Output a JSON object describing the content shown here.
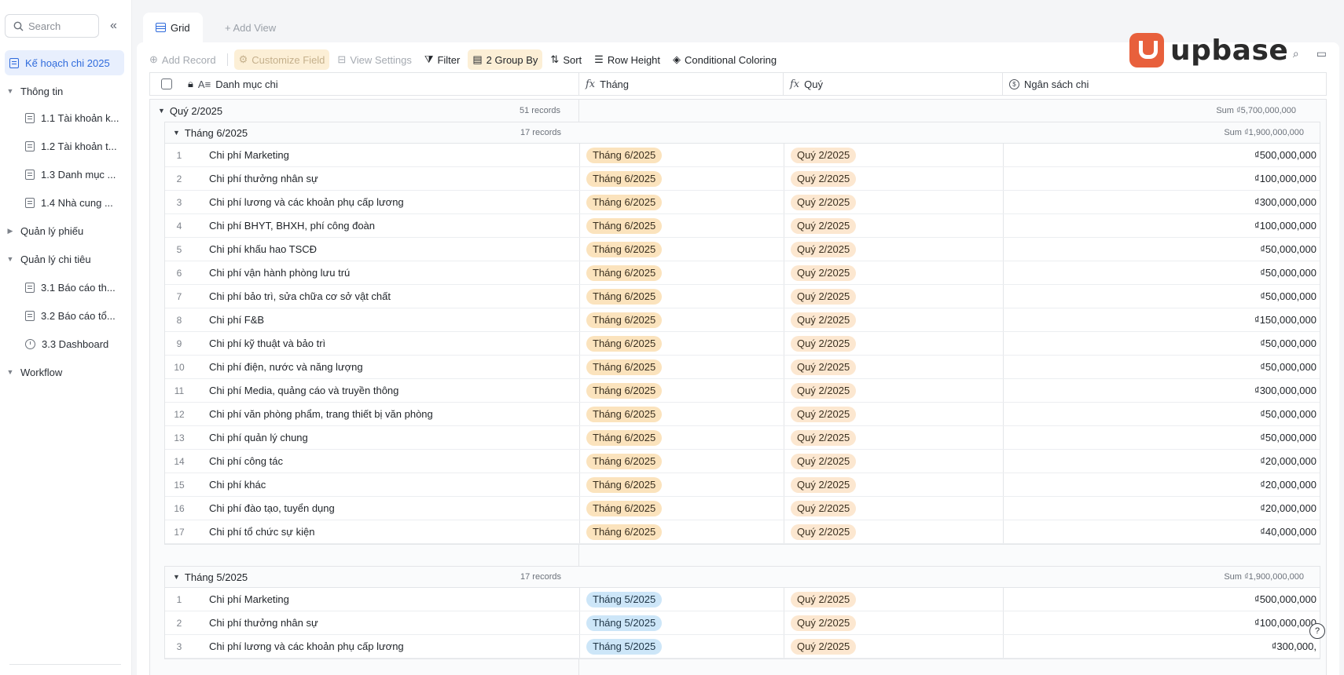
{
  "sidebar": {
    "search_placeholder": "Search",
    "collapse_icon": "double-chevron-left-icon",
    "items": [
      {
        "label": "Kế hoạch chi 2025"
      },
      {
        "label": "Thông tin"
      },
      {
        "label": "1.1 Tài khoản k..."
      },
      {
        "label": "1.2 Tài khoản t..."
      },
      {
        "label": "1.3 Danh mục ..."
      },
      {
        "label": "1.4 Nhà cung ..."
      },
      {
        "label": "Quản lý phiếu"
      },
      {
        "label": "Quản lý chi tiêu"
      },
      {
        "label": "3.1 Báo cáo th..."
      },
      {
        "label": "3.2 Báo cáo tổ..."
      },
      {
        "label": "3.3 Dashboard"
      },
      {
        "label": "Workflow"
      }
    ]
  },
  "tabs": {
    "grid": "Grid",
    "add_view": "+ Add View"
  },
  "toolbar": {
    "add_record": "Add Record",
    "customize_field": "Customize Field",
    "view_settings": "View Settings",
    "filter": "Filter",
    "group_by": "2 Group By",
    "sort": "Sort",
    "row_height": "Row Height",
    "conditional_coloring": "Conditional Coloring"
  },
  "brand": {
    "name": "upbase",
    "color": "#e8603c"
  },
  "columns": {
    "name": "Danh mục chi",
    "thang": "Tháng",
    "quy": "Quý",
    "budget": "Ngân sách chi"
  },
  "group": {
    "title": "Quý 2/2025",
    "count": "51 records",
    "sum": "Sum ₫5,700,000,000"
  },
  "subgroups": [
    {
      "title": "Tháng 6/2025",
      "count": "17 records",
      "sum": "Sum ₫1,900,000,000",
      "rows": [
        {
          "n": "1",
          "name": "Chi phí Marketing",
          "thang": "Tháng 6/2025",
          "quy": "Quý 2/2025",
          "amount": "₫500,000,000"
        },
        {
          "n": "2",
          "name": "Chi phí thưởng nhân sự",
          "thang": "Tháng 6/2025",
          "quy": "Quý 2/2025",
          "amount": "₫100,000,000"
        },
        {
          "n": "3",
          "name": "Chi phí lương và các khoản phụ cấp lương",
          "thang": "Tháng 6/2025",
          "quy": "Quý 2/2025",
          "amount": "₫300,000,000"
        },
        {
          "n": "4",
          "name": "Chi phí BHYT, BHXH, phí công đoàn",
          "thang": "Tháng 6/2025",
          "quy": "Quý 2/2025",
          "amount": "₫100,000,000"
        },
        {
          "n": "5",
          "name": "Chi phí khấu hao TSCĐ",
          "thang": "Tháng 6/2025",
          "quy": "Quý 2/2025",
          "amount": "₫50,000,000"
        },
        {
          "n": "6",
          "name": "Chi phí vận hành phòng lưu trú",
          "thang": "Tháng 6/2025",
          "quy": "Quý 2/2025",
          "amount": "₫50,000,000"
        },
        {
          "n": "7",
          "name": "Chi phí bảo trì, sửa chữa cơ sở vật chất",
          "thang": "Tháng 6/2025",
          "quy": "Quý 2/2025",
          "amount": "₫50,000,000"
        },
        {
          "n": "8",
          "name": "Chi phí F&B",
          "thang": "Tháng 6/2025",
          "quy": "Quý 2/2025",
          "amount": "₫150,000,000"
        },
        {
          "n": "9",
          "name": "Chi phí kỹ thuật và bảo trì",
          "thang": "Tháng 6/2025",
          "quy": "Quý 2/2025",
          "amount": "₫50,000,000"
        },
        {
          "n": "10",
          "name": "Chi phí điện, nước và năng lượng",
          "thang": "Tháng 6/2025",
          "quy": "Quý 2/2025",
          "amount": "₫50,000,000"
        },
        {
          "n": "11",
          "name": "Chi phí Media, quảng cáo và truyền thông",
          "thang": "Tháng 6/2025",
          "quy": "Quý 2/2025",
          "amount": "₫300,000,000"
        },
        {
          "n": "12",
          "name": "Chi phí văn phòng phẩm, trang thiết bị văn phòng",
          "thang": "Tháng 6/2025",
          "quy": "Quý 2/2025",
          "amount": "₫50,000,000"
        },
        {
          "n": "13",
          "name": "Chi phí quản lý chung",
          "thang": "Tháng 6/2025",
          "quy": "Quý 2/2025",
          "amount": "₫50,000,000"
        },
        {
          "n": "14",
          "name": "Chi phí công tác",
          "thang": "Tháng 6/2025",
          "quy": "Quý 2/2025",
          "amount": "₫20,000,000"
        },
        {
          "n": "15",
          "name": "Chi phí khác",
          "thang": "Tháng 6/2025",
          "quy": "Quý 2/2025",
          "amount": "₫20,000,000"
        },
        {
          "n": "16",
          "name": "Chi phí đào tạo, tuyển dụng",
          "thang": "Tháng 6/2025",
          "quy": "Quý 2/2025",
          "amount": "₫20,000,000"
        },
        {
          "n": "17",
          "name": "Chi phí tổ chức sự kiện",
          "thang": "Tháng 6/2025",
          "quy": "Quý 2/2025",
          "amount": "₫40,000,000"
        }
      ]
    },
    {
      "title": "Tháng 5/2025",
      "count": "17 records",
      "sum": "Sum ₫1,900,000,000",
      "rows": [
        {
          "n": "1",
          "name": "Chi phí Marketing",
          "thang": "Tháng 5/2025",
          "quy": "Quý 2/2025",
          "amount": "₫500,000,000"
        },
        {
          "n": "2",
          "name": "Chi phí thưởng nhân sự",
          "thang": "Tháng 5/2025",
          "quy": "Quý 2/2025",
          "amount": "₫100,000,000"
        },
        {
          "n": "3",
          "name": "Chi phí lương và các khoản phụ cấp lương",
          "thang": "Tháng 5/2025",
          "quy": "Quý 2/2025",
          "amount": "₫300,000,"
        }
      ]
    }
  ],
  "help_label": "?"
}
